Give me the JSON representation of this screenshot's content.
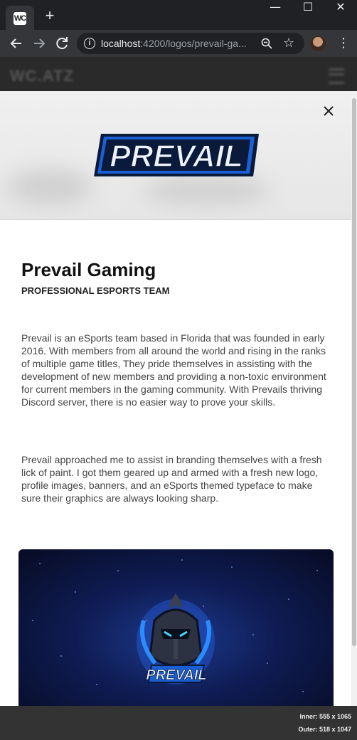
{
  "browser": {
    "tab_favicon_text": "WC",
    "new_tab_label": "+",
    "window_controls": {
      "minimize": "—",
      "maximize": "☐",
      "close": "✕"
    },
    "url_host": "localhost",
    "url_rest": ":4200/logos/prevail-ga...",
    "info_icon": "i",
    "star_icon": "☆",
    "menu_icon": "⋮"
  },
  "site": {
    "logo_text": "WC.ATZ"
  },
  "modal": {
    "close_icon": "close-icon",
    "hero_logo_text": "PREVAIL",
    "title": "Prevail Gaming",
    "subtitle": "PROFESSIONAL ESPORTS TEAM",
    "paragraphs": [
      "Prevail is an eSports team based in Florida that was founded in early 2016. With members from all around the world and rising in the ranks of multiple game titles, They pride themselves in assisting with the development of new members and providing a non-toxic environment for current members in the gaming community. With Prevails thriving Discord server, there is no easier way to prove your skills.",
      "Prevail approached me to assist in branding themselves with a fresh lick of paint. I got them geared up and armed with a fresh new logo, profile images, banners, and an eSports themed typeface to make sure their graphics are always looking sharp."
    ],
    "gallery_logo_text": "PREVAIL"
  },
  "devtools": {
    "inner_size": "Inner: 555 x 1065",
    "outer_size": "Outer: 518 x 1047"
  },
  "colors": {
    "chrome_dark": "#202124",
    "chrome_toolbar": "#35363a",
    "logo_blue": "#1a5fd4",
    "logo_navy": "#0b1a3a"
  }
}
